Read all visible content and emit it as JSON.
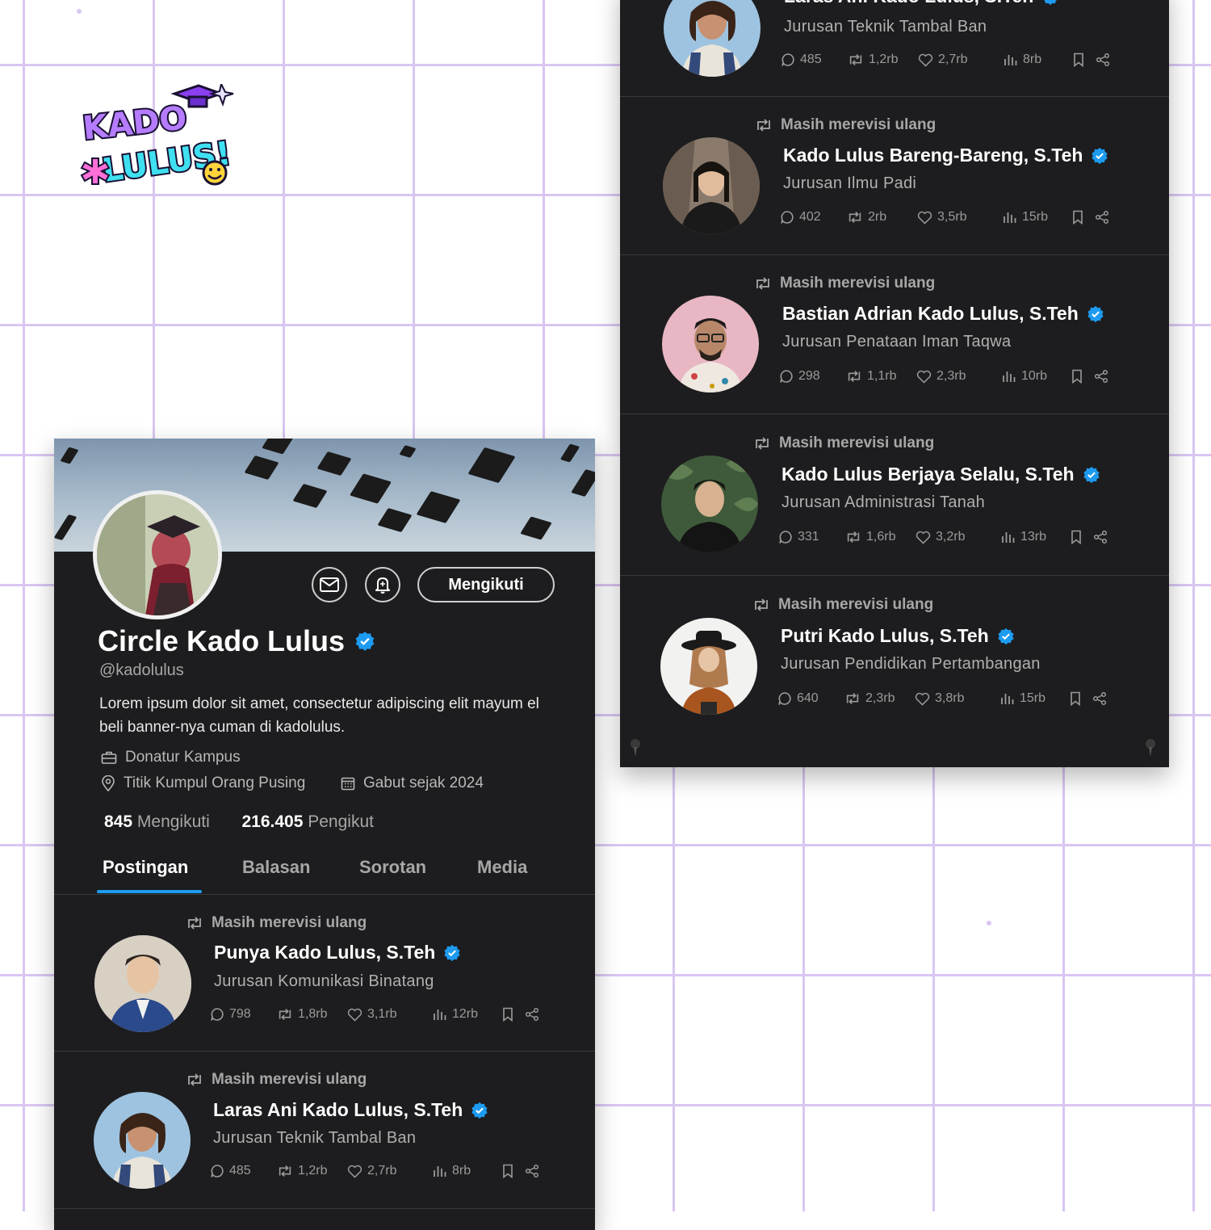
{
  "brand": {
    "logo_text": "KADO LULUS!"
  },
  "profile": {
    "name": "Circle Kado Lulus",
    "handle": "@kadolulus",
    "bio": "Lorem ipsum dolor sit amet, consectetur adipiscing elit mayum el beli banner-nya cuman di kadolulus.",
    "job": "Donatur Kampus",
    "location": "Titik Kumpul Orang Pusing",
    "joined": "Gabut sejak 2024",
    "following_count": "845",
    "following_label": "Mengikuti",
    "followers_count": "216.405",
    "followers_label": "Pengikut",
    "follow_button": "Mengikuti"
  },
  "tabs": [
    {
      "label": "Postingan"
    },
    {
      "label": "Balasan"
    },
    {
      "label": "Sorotan"
    },
    {
      "label": "Media"
    }
  ],
  "left_posts": [
    {
      "repost_label": "Masih merevisi ulang",
      "name": "Punya Kado Lulus, S.Teh",
      "subtitle": "Jurusan Komunikasi Binatang",
      "replies": "798",
      "reposts": "1,8rb",
      "likes": "3,1rb",
      "views": "12rb"
    },
    {
      "repost_label": "Masih merevisi ulang",
      "name": "Laras Ani Kado Lulus, S.Teh",
      "subtitle": "Jurusan Teknik Tambal Ban",
      "replies": "485",
      "reposts": "1,2rb",
      "likes": "2,7rb",
      "views": "8rb"
    }
  ],
  "right_posts": [
    {
      "repost_label": "",
      "name": "Laras Ani Kado Lulus, S.Teh",
      "subtitle": "Jurusan Teknik Tambal Ban",
      "replies": "485",
      "reposts": "1,2rb",
      "likes": "2,7rb",
      "views": "8rb"
    },
    {
      "repost_label": "Masih merevisi ulang",
      "name": "Kado Lulus Bareng-Bareng, S.Teh",
      "subtitle": "Jurusan Ilmu Padi",
      "replies": "402",
      "reposts": "2rb",
      "likes": "3,5rb",
      "views": "15rb"
    },
    {
      "repost_label": "Masih merevisi ulang",
      "name": "Bastian Adrian Kado Lulus, S.Teh",
      "subtitle": "Jurusan Penataan Iman Taqwa",
      "replies": "298",
      "reposts": "1,1rb",
      "likes": "2,3rb",
      "views": "10rb"
    },
    {
      "repost_label": "Masih merevisi ulang",
      "name": "Kado Lulus Berjaya Selalu, S.Teh",
      "subtitle": "Jurusan Administrasi Tanah",
      "replies": "331",
      "reposts": "1,6rb",
      "likes": "3,2rb",
      "views": "13rb"
    },
    {
      "repost_label": "Masih merevisi ulang",
      "name": "Putri Kado Lulus, S.Teh",
      "subtitle": "Jurusan Pendidikan Pertambangan",
      "replies": "640",
      "reposts": "2,3rb",
      "likes": "3,8rb",
      "views": "15rb"
    }
  ],
  "colors": {
    "background": "#ffffff",
    "grid": "#d9c6f2",
    "card": "#1d1d1f",
    "accent": "#1d9bf0",
    "verified": "#1d9bf0"
  }
}
